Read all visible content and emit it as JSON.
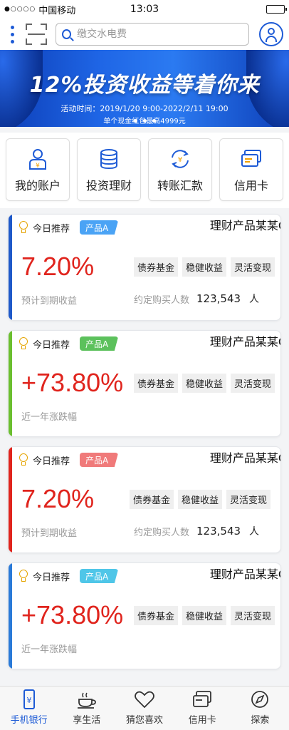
{
  "status": {
    "carrier": "中国移动",
    "time": "13:03",
    "signal": "●○○○○"
  },
  "search": {
    "placeholder": "缴交水电费"
  },
  "banner": {
    "title": "12%投资收益等着你来",
    "time": "活动时间：2019/1/20 9:00-2022/2/11 19:00",
    "note": "单个现金红包最高4999元"
  },
  "quick": [
    {
      "label": "我的账户",
      "icon": "account-icon"
    },
    {
      "label": "投资理财",
      "icon": "investment-icon"
    },
    {
      "label": "转账汇款",
      "icon": "transfer-icon"
    },
    {
      "label": "信用卡",
      "icon": "credit-card-icon"
    }
  ],
  "cards": [
    {
      "rec": "今日推荐",
      "tag": "产品A",
      "tag_color": "#4aa3f5",
      "stripe": "#1f59c9",
      "name": "理财产品某某C",
      "value": "7.20%",
      "sub": "预计到期收益",
      "tags": [
        "债券基金",
        "稳健收益",
        "灵活变现"
      ],
      "buyers_label": "约定购买人数",
      "buyers": "123,543",
      "unit": "人"
    },
    {
      "rec": "今日推荐",
      "tag": "产品A",
      "tag_color": "#5cc15c",
      "stripe": "#6bbf2f",
      "name": "理财产品某某C",
      "value": "+73.80%",
      "sub": "近一年涨跌幅",
      "tags": [
        "债券基金",
        "稳健收益",
        "灵活变现"
      ]
    },
    {
      "rec": "今日推荐",
      "tag": "产品A",
      "tag_color": "#f07a7a",
      "stripe": "#e0241d",
      "name": "理财产品某某C",
      "value": "7.20%",
      "sub": "预计到期收益",
      "tags": [
        "债券基金",
        "稳健收益",
        "灵活变现"
      ],
      "buyers_label": "约定购买人数",
      "buyers": "123,543",
      "unit": "人"
    },
    {
      "rec": "今日推荐",
      "tag": "产品A",
      "tag_color": "#4fc6e8",
      "stripe": "#2a7ad8",
      "name": "理财产品某某C",
      "value": "+73.80%",
      "sub": "近一年涨跌幅",
      "tags": [
        "债券基金",
        "稳健收益",
        "灵活变现"
      ]
    }
  ],
  "tabs": [
    {
      "label": "手机银行",
      "icon": "mobile-bank-icon",
      "active": true
    },
    {
      "label": "享生活",
      "icon": "cup-icon"
    },
    {
      "label": "猜您喜欢",
      "icon": "heart-icon"
    },
    {
      "label": "信用卡",
      "icon": "card-icon"
    },
    {
      "label": "探索",
      "icon": "compass-icon"
    }
  ],
  "colors": {
    "accent": "#1e5bd6",
    "value_red": "#e0241d"
  }
}
